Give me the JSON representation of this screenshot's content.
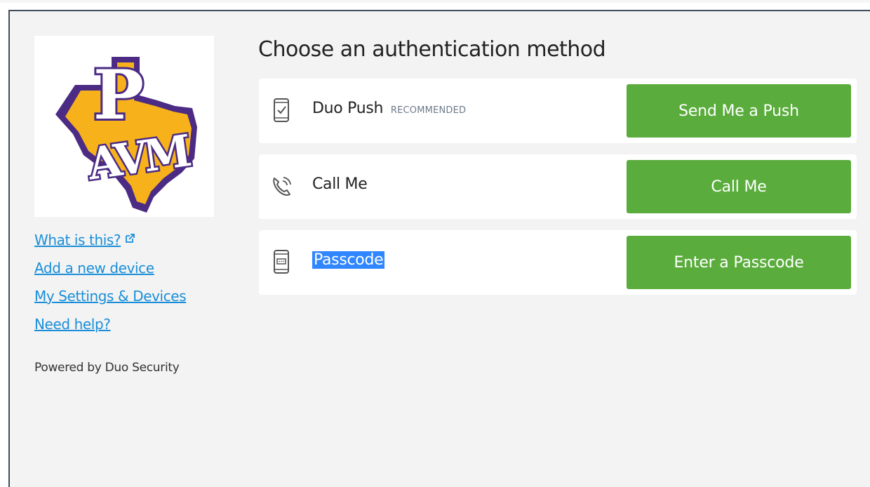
{
  "sidebar": {
    "links": [
      {
        "label": "What is this?",
        "external": true
      },
      {
        "label": "Add a new device"
      },
      {
        "label": "My Settings & Devices"
      },
      {
        "label": "Need help?"
      }
    ],
    "powered_by": "Powered by Duo Security"
  },
  "logo": {
    "letters_top": "P",
    "letters_bottom": "AVM"
  },
  "main": {
    "heading": "Choose an authentication method",
    "methods": [
      {
        "label": "Duo Push",
        "badge": "RECOMMENDED",
        "button": "Send Me a Push",
        "icon": "phone-check-icon"
      },
      {
        "label": "Call Me",
        "button": "Call Me",
        "icon": "phone-call-icon"
      },
      {
        "label": "Passcode",
        "button": "Enter a Passcode",
        "icon": "phone-passcode-icon",
        "selected": true
      }
    ]
  },
  "colors": {
    "button_green": "#5aad3c",
    "link_blue": "#1a8ed8",
    "selection_blue": "#2f86ff",
    "logo_gold": "#f7b21b",
    "logo_purple": "#4b2b84"
  }
}
